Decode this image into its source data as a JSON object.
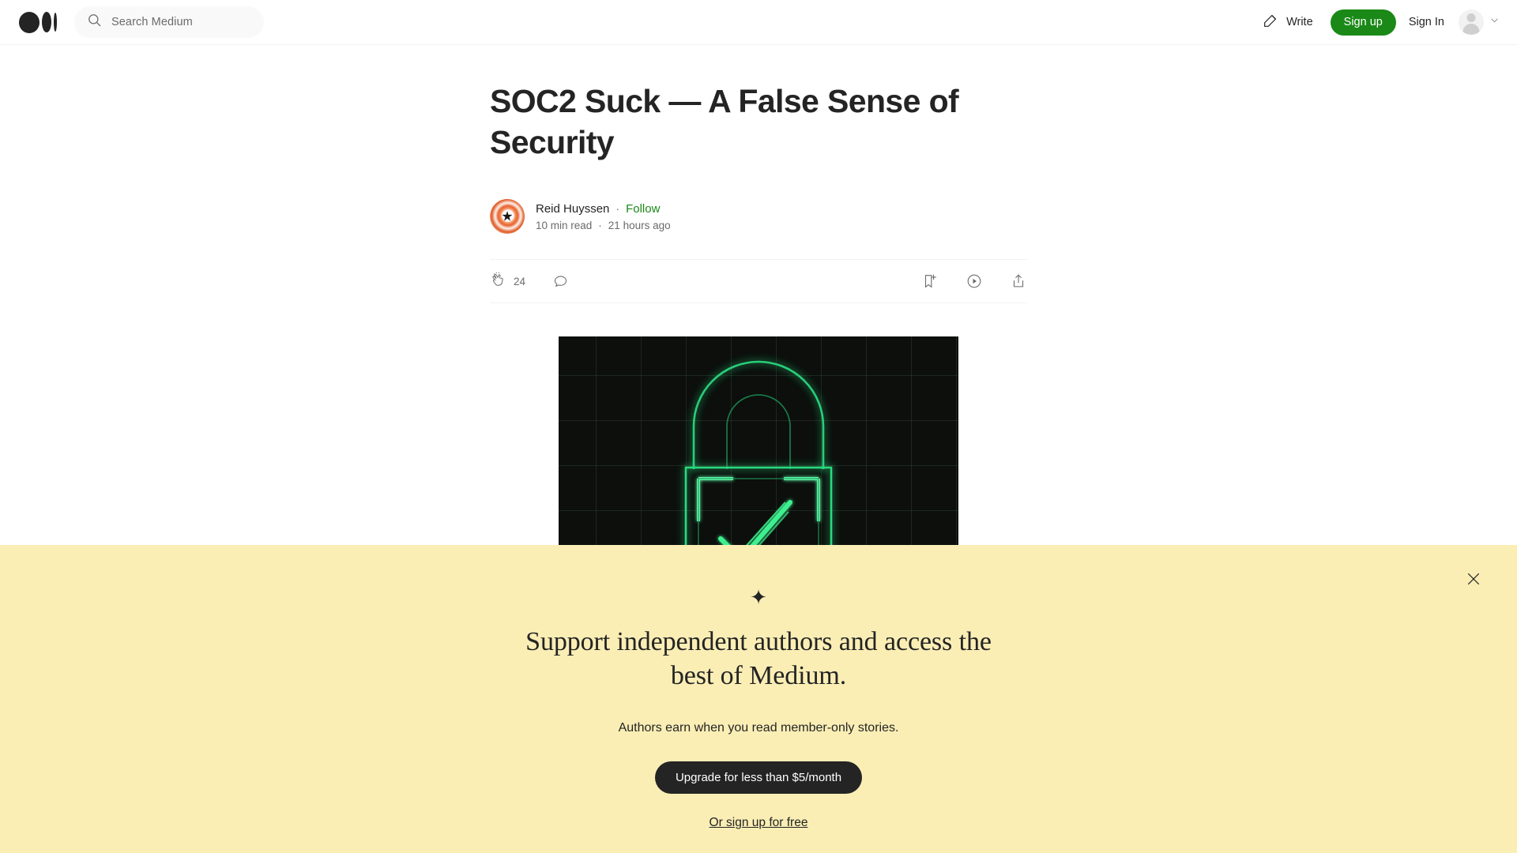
{
  "header": {
    "logo_name": "medium-logo",
    "search": {
      "placeholder": "Search Medium",
      "value": "",
      "icon": "search-icon"
    },
    "write_label": "Write",
    "write_icon": "pencil-write-icon",
    "signup_label": "Sign up",
    "signin_label": "Sign In",
    "avatar_icon": "user-avatar-placeholder",
    "chevron_icon": "chevron-down-icon",
    "accent_green": "#1a8917"
  },
  "article": {
    "title": "SOC2 Suck — A False Sense of Security",
    "author": {
      "name": "Reid Huyssen",
      "avatar_icon": "author-avatar",
      "separator": "·",
      "follow_label": "Follow"
    },
    "read_time": "10 min read",
    "published": "21 hours ago",
    "meta_separator": "·",
    "toolbar": {
      "clap_icon": "clap-icon",
      "clap_count": "24",
      "comment_icon": "comment-icon",
      "save_icon": "bookmark-add-icon",
      "listen_icon": "play-circle-icon",
      "share_icon": "share-icon"
    },
    "hero": {
      "name": "padlock-checkmark-illustration",
      "background_color": "#0c0f0c",
      "neon_color": "#3ddc84"
    }
  },
  "banner": {
    "background_color": "#faeeb5",
    "sparkle_icon": "sparkle-icon",
    "title": "Support independent authors and access the best of Medium.",
    "subtitle": "Authors earn when you read member-only stories.",
    "cta_label": "Upgrade for less than $5/month",
    "secondary_link": "Or sign up for free",
    "close_icon": "close-icon"
  }
}
